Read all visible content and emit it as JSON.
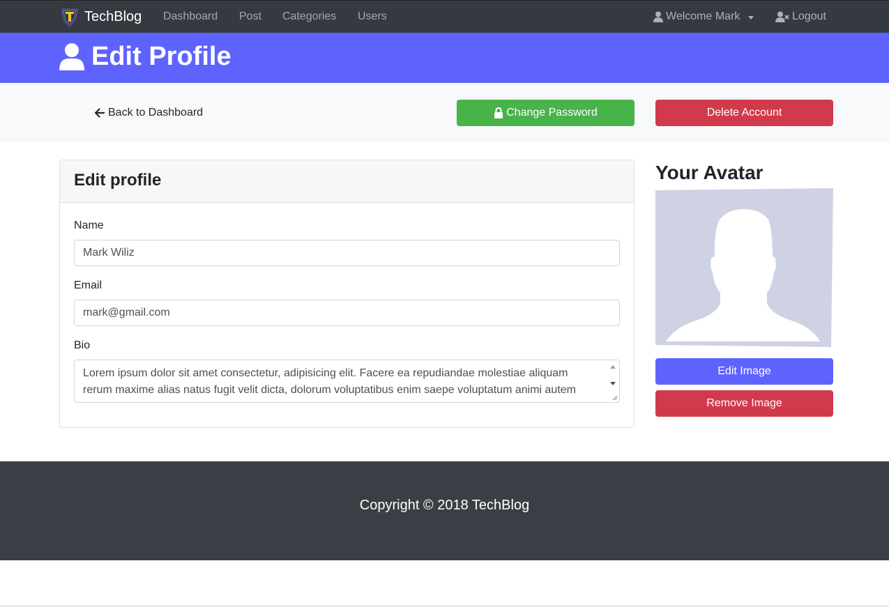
{
  "navbar": {
    "brand": "TechBlog",
    "links": [
      "Dashboard",
      "Post",
      "Categories",
      "Users"
    ],
    "welcome": "Welcome Mark",
    "logout": "Logout"
  },
  "header": {
    "title": "Edit Profile"
  },
  "actions": {
    "back": "Back to Dashboard",
    "change_password": "Change Password",
    "delete_account": "Delete Account"
  },
  "form": {
    "title": "Edit profile",
    "name_label": "Name",
    "name_value": "Mark Wiliz",
    "email_label": "Email",
    "email_value": "mark@gmail.com",
    "bio_label": "Bio",
    "bio_value": "Lorem ipsum dolor sit amet consectetur, adipisicing elit. Facere ea repudiandae molestiae aliquam rerum maxime alias natus fugit velit dicta, dolorum voluptatibus enim saepe voluptatum animi autem"
  },
  "avatar": {
    "title": "Your Avatar",
    "edit": "Edit Image",
    "remove": "Remove Image"
  },
  "footer": {
    "copyright": "Copyright © 2018 TechBlog"
  },
  "colors": {
    "navbar": "#343a40",
    "header": "#5f63fd",
    "success": "#48b349",
    "danger": "#d13a4c",
    "footer": "#3c3e45",
    "avatar_bg": "#cfd2e3"
  },
  "icons": [
    "brand-logo-icon",
    "user-icon",
    "user-times-icon",
    "caret-down-icon",
    "arrow-left-icon",
    "lock-icon",
    "avatar-silhouette"
  ]
}
